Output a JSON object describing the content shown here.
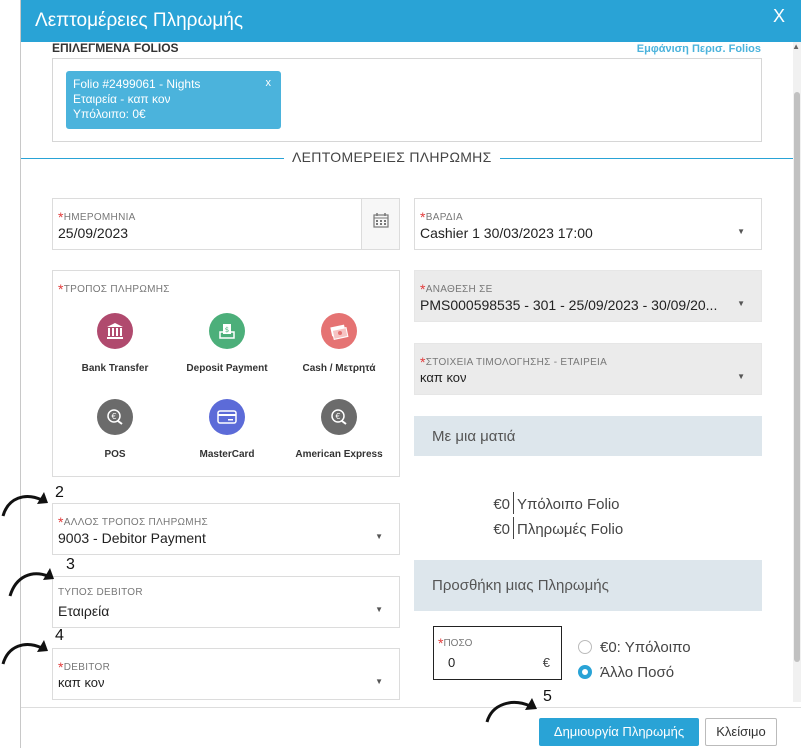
{
  "header": {
    "title": "Λεπτομέρειες Πληρωμής",
    "close_label": "X"
  },
  "folios": {
    "label": "ΕΠΙΛΕΓΜΕΝΑ FOLIOS",
    "show_more": "Εμφάνιση Περισ. Folios",
    "chip": {
      "line1": "Folio #2499061 - Nights",
      "line2": "Εταιρεία - καπ κον",
      "line3": "Υπόλοιπο: 0€",
      "remove": "x"
    }
  },
  "section_title": "ΛΕΠΤΟΜΕΡΕΙΕΣ ΠΛΗΡΩΜΗΣ",
  "required_mark": "*",
  "date_field": {
    "label": "ΗΜΕΡΟΜΗΝΙΑ",
    "value": "25/09/2023",
    "icon": "calendar-icon"
  },
  "shift_field": {
    "label": "ΒΑΡΔΙΑ",
    "value": "Cashier 1 30/03/2023 17:00"
  },
  "payment_methods": {
    "label": "ΤΡΟΠΟΣ ΠΛΗΡΩΜΗΣ",
    "items": [
      {
        "label": "Bank Transfer",
        "icon": "bank-icon",
        "color": "#b04a6e"
      },
      {
        "label": "Deposit Payment",
        "icon": "deposit-icon",
        "color": "#4caf7a"
      },
      {
        "label": "Cash / Μετρητά",
        "icon": "cash-icon",
        "color": "#e57373"
      },
      {
        "label": "POS",
        "icon": "euro-coin-icon",
        "color": "#6b6b6b"
      },
      {
        "label": "MasterCard",
        "icon": "credit-card-icon",
        "color": "#5c6bd8"
      },
      {
        "label": "American Express",
        "icon": "euro-coin-icon",
        "color": "#6b6b6b"
      }
    ]
  },
  "assign_field": {
    "label": "ΑΝΑΘΕΣΗ ΣΕ",
    "value": "PMS000598535 - 301 - 25/09/2023 - 30/09/20..."
  },
  "invoice_field": {
    "label": "ΣΤΟΙΧΕΙΑ ΤΙΜΟΛΟΓΗΣΗΣ - ΕΤΑΙΡΕΙΑ",
    "value": "καπ κον"
  },
  "other_method_field": {
    "label": "ΑΛΛΟΣ ΤΡΟΠΟΣ ΠΛΗΡΩΜΗΣ",
    "value": "9003 - Debitor Payment"
  },
  "debitor_type_field": {
    "label": "ΤΥΠΟΣ DEBITOR",
    "value": "Εταιρεία"
  },
  "debitor_field": {
    "label": "DEBITOR",
    "value": "καπ κον"
  },
  "glance": {
    "title": "Με μια ματιά",
    "rows": [
      {
        "amount": "€0",
        "label": "Υπόλοιπο Folio"
      },
      {
        "amount": "€0",
        "label": "Πληρωμές Folio"
      }
    ]
  },
  "add_payment": {
    "title": "Προσθήκη μιας Πληρωμής",
    "amount_label": "ΠΟΣΟ",
    "amount_value": "0",
    "currency": "€",
    "radio_remaining": "€0: Υπόλοιπο",
    "radio_other": "Άλλο Ποσό",
    "selected": "other"
  },
  "buttons": {
    "create": "Δημιουργία Πληρωμής",
    "close": "Κλείσιμο"
  },
  "annotations": [
    "2",
    "3",
    "4",
    "5"
  ],
  "colors": {
    "accent": "#29a3d6",
    "panel": "#dde6ec",
    "required": "#e23b3b"
  }
}
